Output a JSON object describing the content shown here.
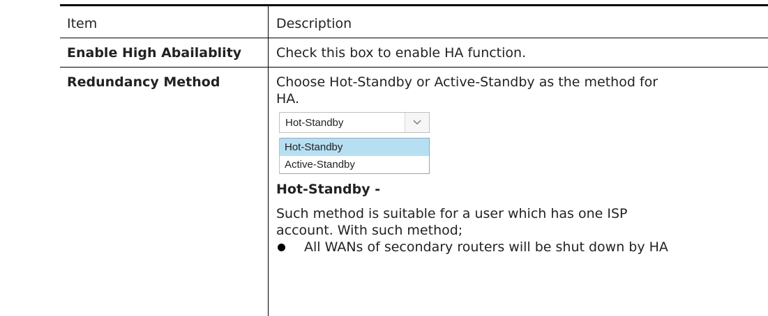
{
  "table": {
    "headers": {
      "item": "Item",
      "description": "Description"
    },
    "rows": [
      {
        "item": "Enable High Abailablity",
        "description": "Check this box to enable HA function."
      },
      {
        "item": "Redundancy Method",
        "description_lines": [
          "Choose Hot-Standby or Active-Standby as the method for",
          "HA."
        ],
        "select": {
          "value": "Hot-Standby",
          "options": [
            "Hot-Standby",
            "Active-Standby"
          ],
          "highlighted_option": "Hot-Standby"
        },
        "subheading": "Hot-Standby -",
        "paragraph_lines": [
          "Such method is suitable for a user which has one ISP",
          "account. With such method;"
        ],
        "bullets": [
          "All WANs of secondary routers will be shut down by HA"
        ]
      }
    ]
  },
  "colors": {
    "rule": "#000000",
    "option_highlight": "#b7dff2",
    "text": "#222222"
  },
  "icons": {
    "select_arrow": "chevron-down-icon",
    "bullet": "bullet-dot-icon"
  }
}
